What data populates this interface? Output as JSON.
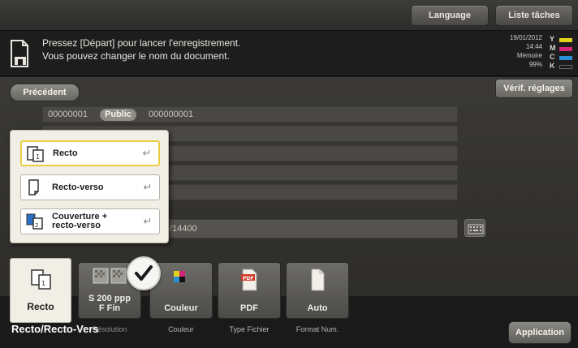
{
  "header": {
    "language_label": "Language",
    "job_list_label": "Liste tâches"
  },
  "message": {
    "line1": "Pressez [Départ] pour lancer l'enregistrement.",
    "line2": "Vous pouvez changer le nom du document.",
    "icon": "document-icon"
  },
  "status": {
    "date": "19/01/2012",
    "time": "14:44",
    "memory_label": "Mémoire",
    "memory_value": "99%",
    "toner": [
      {
        "letter": "Y",
        "color": "#e3d21c"
      },
      {
        "letter": "M",
        "color": "#d6247a"
      },
      {
        "letter": "C",
        "color": "#2a8fd6"
      },
      {
        "letter": "K",
        "color": "#1a1a1a"
      }
    ]
  },
  "verify_settings_label": "Vérif. réglages",
  "previous_label": "Précédent",
  "fields": {
    "box_number": "00000001",
    "box_type": "Public",
    "box_name": "000000001",
    "document_name_partial": "/14400"
  },
  "popup": {
    "options": [
      {
        "label": "Recto",
        "icon": "single-sided-icon",
        "selected": true
      },
      {
        "label": "Recto-verso",
        "icon": "double-sided-icon",
        "selected": false
      },
      {
        "label_line1": "Couverture +",
        "label_line2": "recto-verso",
        "icon": "cover-duplex-icon",
        "selected": false
      }
    ]
  },
  "functions": {
    "recto": {
      "label": "Recto",
      "caption": "Recto/Recto-Vers"
    },
    "resolution": {
      "line1": "S 200 ppp",
      "line2": "F Fin",
      "caption": "Résolution"
    },
    "color": {
      "label": "Couleur",
      "caption": "Couleur"
    },
    "file_type": {
      "label": "PDF",
      "caption": "Type Fichier"
    },
    "scan_size": {
      "label": "Auto",
      "caption": "Format Num."
    }
  },
  "application_label": "Application"
}
